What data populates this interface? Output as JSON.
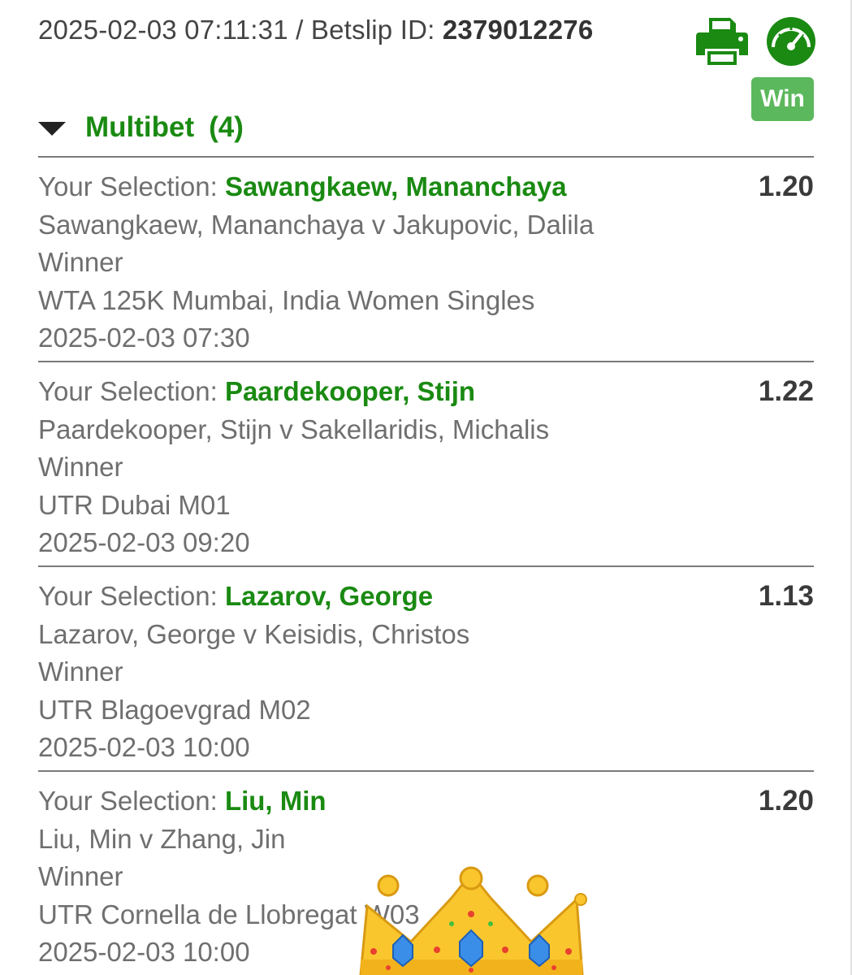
{
  "header": {
    "timestamp": "2025-02-03 07:11:31",
    "separator": " / ",
    "betslip_label": "Betslip ID: ",
    "betslip_id": "2379012276"
  },
  "icons": {
    "print": "printer-icon",
    "gauge": "speedometer-icon",
    "crown": "crown-emoji"
  },
  "status_badge": "Win",
  "multibet": {
    "label": "Multibet",
    "count": "(4)"
  },
  "selection_prefix": "Your Selection: ",
  "selections": [
    {
      "pick": "Sawangkaew, Mananchaya",
      "odds": "1.20",
      "event": "Sawangkaew, Mananchaya v Jakupovic, Dalila",
      "market": "Winner",
      "competition": "WTA 125K Mumbai, India Women Singles",
      "datetime": "2025-02-03 07:30"
    },
    {
      "pick": "Paardekooper, Stijn",
      "odds": "1.22",
      "event": "Paardekooper, Stijn v Sakellaridis, Michalis",
      "market": "Winner",
      "competition": "UTR Dubai M01",
      "datetime": "2025-02-03 09:20"
    },
    {
      "pick": "Lazarov, George",
      "odds": "1.13",
      "event": "Lazarov, George v Keisidis, Christos",
      "market": "Winner",
      "competition": "UTR Blagoevgrad M02",
      "datetime": "2025-02-03 10:00"
    },
    {
      "pick": "Liu, Min",
      "odds": "1.20",
      "event": "Liu, Min v Zhang, Jin",
      "market": "Winner",
      "competition": "UTR Cornella de Llobregat W03",
      "datetime": "2025-02-03 10:00"
    }
  ],
  "colors": {
    "brand_green": "#1a8a12",
    "badge_green": "#5cb85c",
    "text_gray": "#6f6f6f",
    "divider": "#7a7a7a"
  }
}
